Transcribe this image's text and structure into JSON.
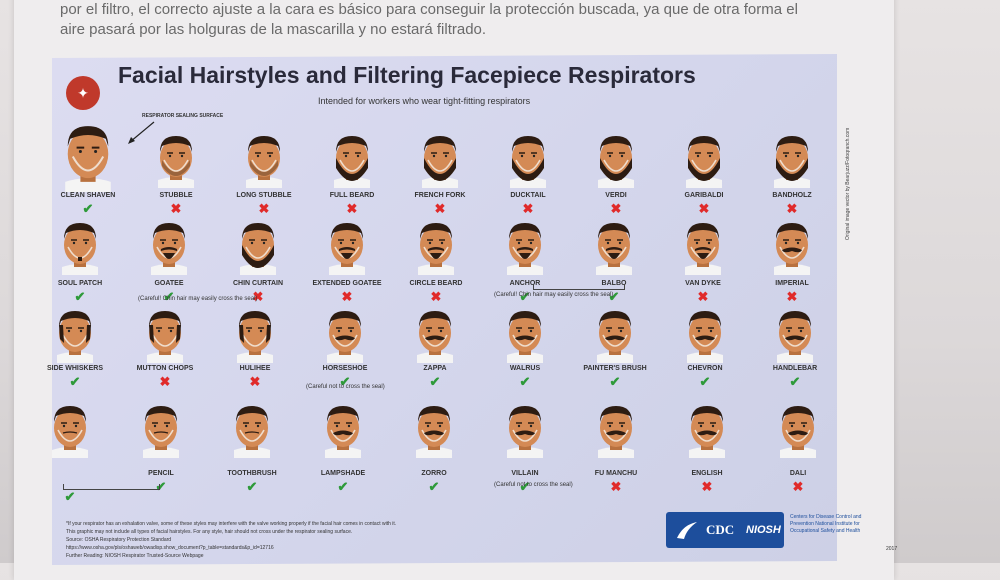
{
  "article": {
    "line1": "por el filtro, el correcto ajuste a la cara es básico para conseguir la protección buscada, ya que de otra forma el",
    "line2": "aire pasará por las holguras de la mascarilla y no estará filtrado."
  },
  "poster": {
    "title": "Facial Hairstyles and Filtering Facepiece Respirators",
    "subtitle": "Intended for workers who wear tight-fitting respirators",
    "sealing_label": "RESPIRATOR SEALING SURFACE",
    "side_credit": "Original image vector by Bearjuzz/Fotoqranch.com",
    "code": "2017",
    "org_caption": "Centers for Disease Control and Prevention National Institute for Occupational Safety and Health",
    "logo_cdc": "CDC",
    "logo_niosh": "NIOSH",
    "footnotes": [
      "*If your respirator has an exhalation valve, some of these styles may interfere with the valve working properly if the facial hair comes in contact with it.",
      "This graphic may not include all types of facial hairstyles. For any style, hair should not cross under the respirator sealing surface.",
      "Source: OSHA Respiratory Protection Standard",
      "https://www.osha.gov/pls/oshaweb/owadisp.show_document?p_table=standards&p_id=12716",
      "Further Reading: NIOSH Respirator Trusted-Source Webpage"
    ],
    "notes": {
      "goatee": "(Careful! Chin hair may easily cross the seal)",
      "anchor_balbo": "(Careful! Chin hair may easily cross the seal)",
      "horseshoe": "(Careful not to cross the seal)",
      "villain": "(Careful not to cross the seal)"
    },
    "styles": [
      {
        "label": "CLEAN SHAVEN",
        "ok": true,
        "hair": "none"
      },
      {
        "label": "STUBBLE",
        "ok": false,
        "hair": "stubble"
      },
      {
        "label": "LONG STUBBLE",
        "ok": false,
        "hair": "stubble"
      },
      {
        "label": "FULL BEARD",
        "ok": false,
        "hair": "beard"
      },
      {
        "label": "FRENCH FORK",
        "ok": false,
        "hair": "beard"
      },
      {
        "label": "DUCKTAIL",
        "ok": false,
        "hair": "beard"
      },
      {
        "label": "VERDI",
        "ok": false,
        "hair": "beard"
      },
      {
        "label": "GARIBALDI",
        "ok": false,
        "hair": "beard"
      },
      {
        "label": "BANDHOLZ",
        "ok": false,
        "hair": "beard"
      },
      {
        "label": "SOUL PATCH",
        "ok": true,
        "hair": "patch"
      },
      {
        "label": "GOATEE",
        "ok": true,
        "hair": "goatee"
      },
      {
        "label": "CHIN CURTAIN",
        "ok": false,
        "hair": "beard"
      },
      {
        "label": "EXTENDED GOATEE",
        "ok": false,
        "hair": "goatee"
      },
      {
        "label": "CIRCLE BEARD",
        "ok": false,
        "hair": "goatee"
      },
      {
        "label": "ANCHOR",
        "ok": true,
        "hair": "goatee"
      },
      {
        "label": "BALBO",
        "ok": true,
        "hair": "goatee"
      },
      {
        "label": "VAN DYKE",
        "ok": false,
        "hair": "goatee"
      },
      {
        "label": "IMPERIAL",
        "ok": false,
        "hair": "mustache"
      },
      {
        "label": "SIDE WHISKERS",
        "ok": true,
        "hair": "sides"
      },
      {
        "label": "MUTTON CHOPS",
        "ok": false,
        "hair": "sides"
      },
      {
        "label": "HULIHEE",
        "ok": false,
        "hair": "sides"
      },
      {
        "label": "HORSESHOE",
        "ok": true,
        "hair": "mustache"
      },
      {
        "label": "ZAPPA",
        "ok": true,
        "hair": "mustache"
      },
      {
        "label": "WALRUS",
        "ok": true,
        "hair": "mustache"
      },
      {
        "label": "PAINTER'S BRUSH",
        "ok": true,
        "hair": "mustache"
      },
      {
        "label": "CHEVRON",
        "ok": true,
        "hair": "mustache"
      },
      {
        "label": "HANDLEBAR",
        "ok": true,
        "hair": "mustache"
      },
      {
        "label": "",
        "ok": true,
        "hair": "thin"
      },
      {
        "label": "PENCIL",
        "ok": true,
        "hair": "thin"
      },
      {
        "label": "TOOTHBRUSH",
        "ok": true,
        "hair": "thin"
      },
      {
        "label": "LAMPSHADE",
        "ok": true,
        "hair": "mustache"
      },
      {
        "label": "ZORRO",
        "ok": true,
        "hair": "mustache"
      },
      {
        "label": "VILLAIN",
        "ok": true,
        "hair": "mustache"
      },
      {
        "label": "FU MANCHU",
        "ok": false,
        "hair": "mustache"
      },
      {
        "label": "ENGLISH",
        "ok": false,
        "hair": "mustache"
      },
      {
        "label": "DALI",
        "ok": false,
        "hair": "mustache"
      }
    ]
  }
}
